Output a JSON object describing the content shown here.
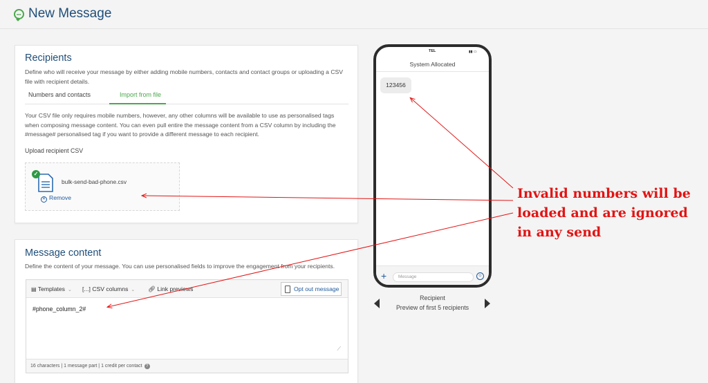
{
  "header": {
    "title": "New Message",
    "icon": "chat-bubble-icon"
  },
  "recipients": {
    "title": "Recipients",
    "description": "Define who will receive your message by either adding mobile numbers, contacts and contact groups or uploading a CSV file with recipient details.",
    "tabs": [
      {
        "label": "Numbers and contacts",
        "active": false
      },
      {
        "label": "Import from file",
        "active": true
      }
    ],
    "csv_info": "Your CSV file only requires mobile numbers, however, any other columns will be available to use as personalised tags when composing message content. You can even pull entire the message content from a CSV column by including the #message# personalised tag if you want to provide a different message to each recipient.",
    "upload_label": "Upload recipient CSV",
    "file": {
      "name": "bulk-send-bad-phone.csv",
      "remove_label": "Remove"
    }
  },
  "message_content": {
    "title": "Message content",
    "description": "Define the content of your message. You can use personalised fields to improve the engagement from your recipients.",
    "toolbar": {
      "templates": "Templates",
      "csv_columns": "CSV columns",
      "csv_prefix": "[...]",
      "link_previews": "Link previews",
      "opt_out": "Opt out message"
    },
    "text": "#phone_column_2#",
    "status": "16 characters | 1 message part | 1 credit per contact"
  },
  "phone_preview": {
    "carrier": "TEL",
    "sender": "System Allocated",
    "bubble_text": "123456",
    "input_placeholder": "Message",
    "recipient_label": "Recipient",
    "recipient_sub": "Preview of first 5 recipients"
  },
  "annotation": {
    "lines": [
      "Invalid numbers will be",
      "loaded and are ignored",
      "in any send"
    ],
    "color": "#e21414"
  },
  "colors": {
    "accent_green": "#49a84b",
    "title_blue": "#1f4e79",
    "link_blue": "#1f5a9e"
  }
}
